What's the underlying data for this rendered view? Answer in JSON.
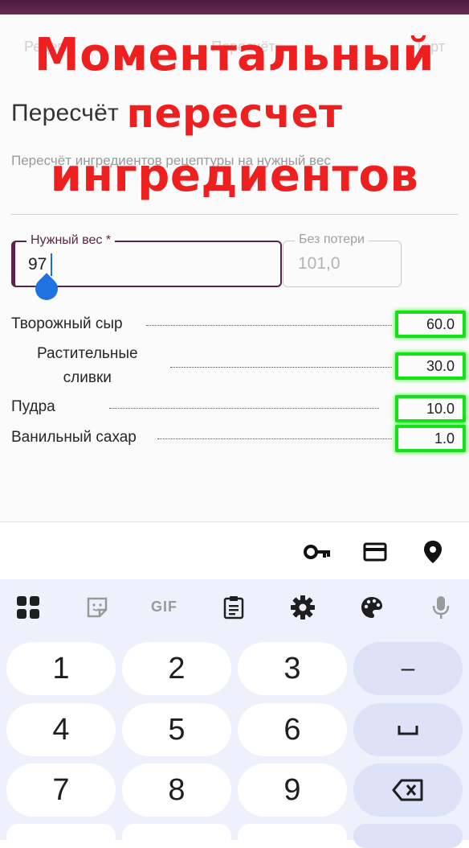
{
  "app": {
    "tabs_ghost": [
      "Рецепт",
      "Пересчёт",
      "Торт"
    ],
    "page_title": "Пересчёт",
    "page_subtitle": "Пересчёт ингредиентов рецептуры на нужный вес"
  },
  "overlay": {
    "line1": "Моментальный",
    "line2": "пересчет",
    "line3": "ингредиентов"
  },
  "fields": {
    "weight_label": "Нужный вес *",
    "weight_value": "97",
    "loss_label": "Без потери",
    "loss_value": "101,0"
  },
  "ingredients": [
    {
      "name": "Творожный сыр",
      "value": "60.0"
    },
    {
      "name": "Растительные\nсливки",
      "value": "30.0"
    },
    {
      "name": "Пудра",
      "value": "10.0"
    },
    {
      "name": "Ванильный сахар",
      "value": "1.0"
    }
  ],
  "keyboard": {
    "toolbar_gif": "GIF",
    "rows": [
      [
        "1",
        "2",
        "3",
        "–"
      ],
      [
        "4",
        "5",
        "6",
        "␣"
      ],
      [
        "7",
        "8",
        "9",
        "⌫"
      ]
    ],
    "highlight_color": "#16e016",
    "accent_color": "#5a2448"
  }
}
